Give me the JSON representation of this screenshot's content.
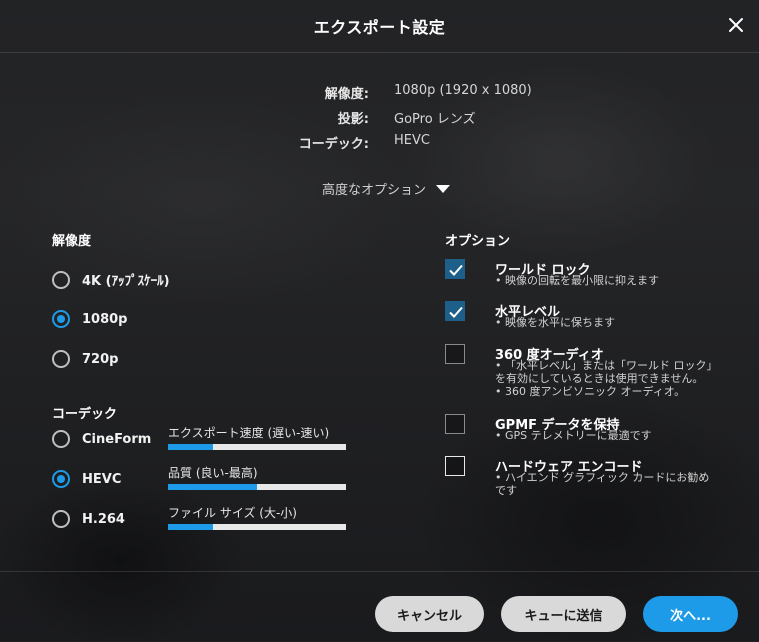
{
  "dialog": {
    "title": "エクスポート設定"
  },
  "summary": [
    {
      "label": "解像度:",
      "value": "1080p (1920 x 1080)"
    },
    {
      "label": "投影:",
      "value": "GoPro レンズ"
    },
    {
      "label": "コーデック:",
      "value": "HEVC"
    }
  ],
  "advanced_label": "高度なオプション",
  "resolution": {
    "heading": "解像度",
    "options": [
      {
        "label": "4K (ｱｯﾌﾟｽｹｰﾙ)",
        "selected": false
      },
      {
        "label": "1080p",
        "selected": true
      },
      {
        "label": "720p",
        "selected": false
      }
    ]
  },
  "codec": {
    "heading": "コーデック",
    "options": [
      {
        "label": "CineForm",
        "selected": false
      },
      {
        "label": "HEVC",
        "selected": true
      },
      {
        "label": "H.264",
        "selected": false
      }
    ],
    "meters": [
      {
        "label": "エクスポート速度 (遅い-速い)",
        "level": 0.25
      },
      {
        "label": "品質 (良い-最高)",
        "level": 0.5
      },
      {
        "label": "ファイル サイズ (大-小)",
        "level": 0.25
      }
    ]
  },
  "options": {
    "heading": "オプション",
    "items": [
      {
        "title": "ワールド ロック",
        "desc": "• 映像の回転を最小限に抑えます",
        "checked": true,
        "enabled": true
      },
      {
        "title": "水平レベル",
        "desc": "• 映像を水平に保ちます",
        "checked": true,
        "enabled": true
      },
      {
        "title": "360 度オーディオ",
        "desc": "• 「水平レベル」または「ワールド ロック」を有効にしているときは使用できません。\n• 360 度アンビソニック オーディオ。",
        "checked": false,
        "enabled": false
      },
      {
        "title": "GPMF データを保持",
        "desc": "• GPS テレメトリーに最適です",
        "checked": false,
        "enabled": false
      },
      {
        "title": "ハードウェア エンコード",
        "desc": "• ハイエンド グラフィック カードにお勧めです",
        "checked": false,
        "enabled": true
      }
    ]
  },
  "buttons": {
    "cancel": "キャンセル",
    "queue": "キューに送信",
    "next": "次へ..."
  },
  "colors": {
    "accent": "#1e9be8",
    "checkbox_checked": "#1e5f8a"
  },
  "icons": {
    "close": "close-icon",
    "dropdown": "triangle-down-icon",
    "check": "check-icon"
  }
}
